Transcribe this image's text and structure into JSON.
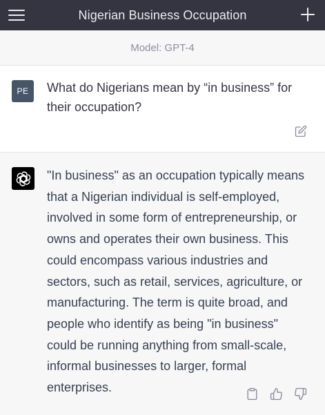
{
  "header": {
    "title": "Nigerian Business Occupation",
    "menu_icon": "hamburger-menu-icon",
    "new_chat_icon": "plus-icon"
  },
  "model_bar": {
    "label": "Model: GPT-4"
  },
  "user_message": {
    "avatar_text": "PE",
    "text": "What do Nigerians mean by “in business” for their occupation?",
    "edit_icon": "edit-icon"
  },
  "assistant_message": {
    "avatar_icon": "openai-logo-icon",
    "text": "\"In business\" as an occupation typically means that a Nigerian individual is self-employed, involved in some form of entrepreneurship, or owns and operates their own business. This could encompass various industries and sectors, such as retail, services, agriculture, or manufacturing. The term is quite broad, and people who identify as being \"in business\" could be running anything from small-scale, informal businesses to larger, formal enterprises.",
    "actions": [
      "copy-icon",
      "thumbs-up-icon",
      "thumbs-down-icon"
    ]
  },
  "colors": {
    "topbar_bg": "#343541",
    "model_bar_bg": "#f7f7f8",
    "user_avatar_bg": "#475569",
    "assistant_bg": "#f7f7f8"
  }
}
